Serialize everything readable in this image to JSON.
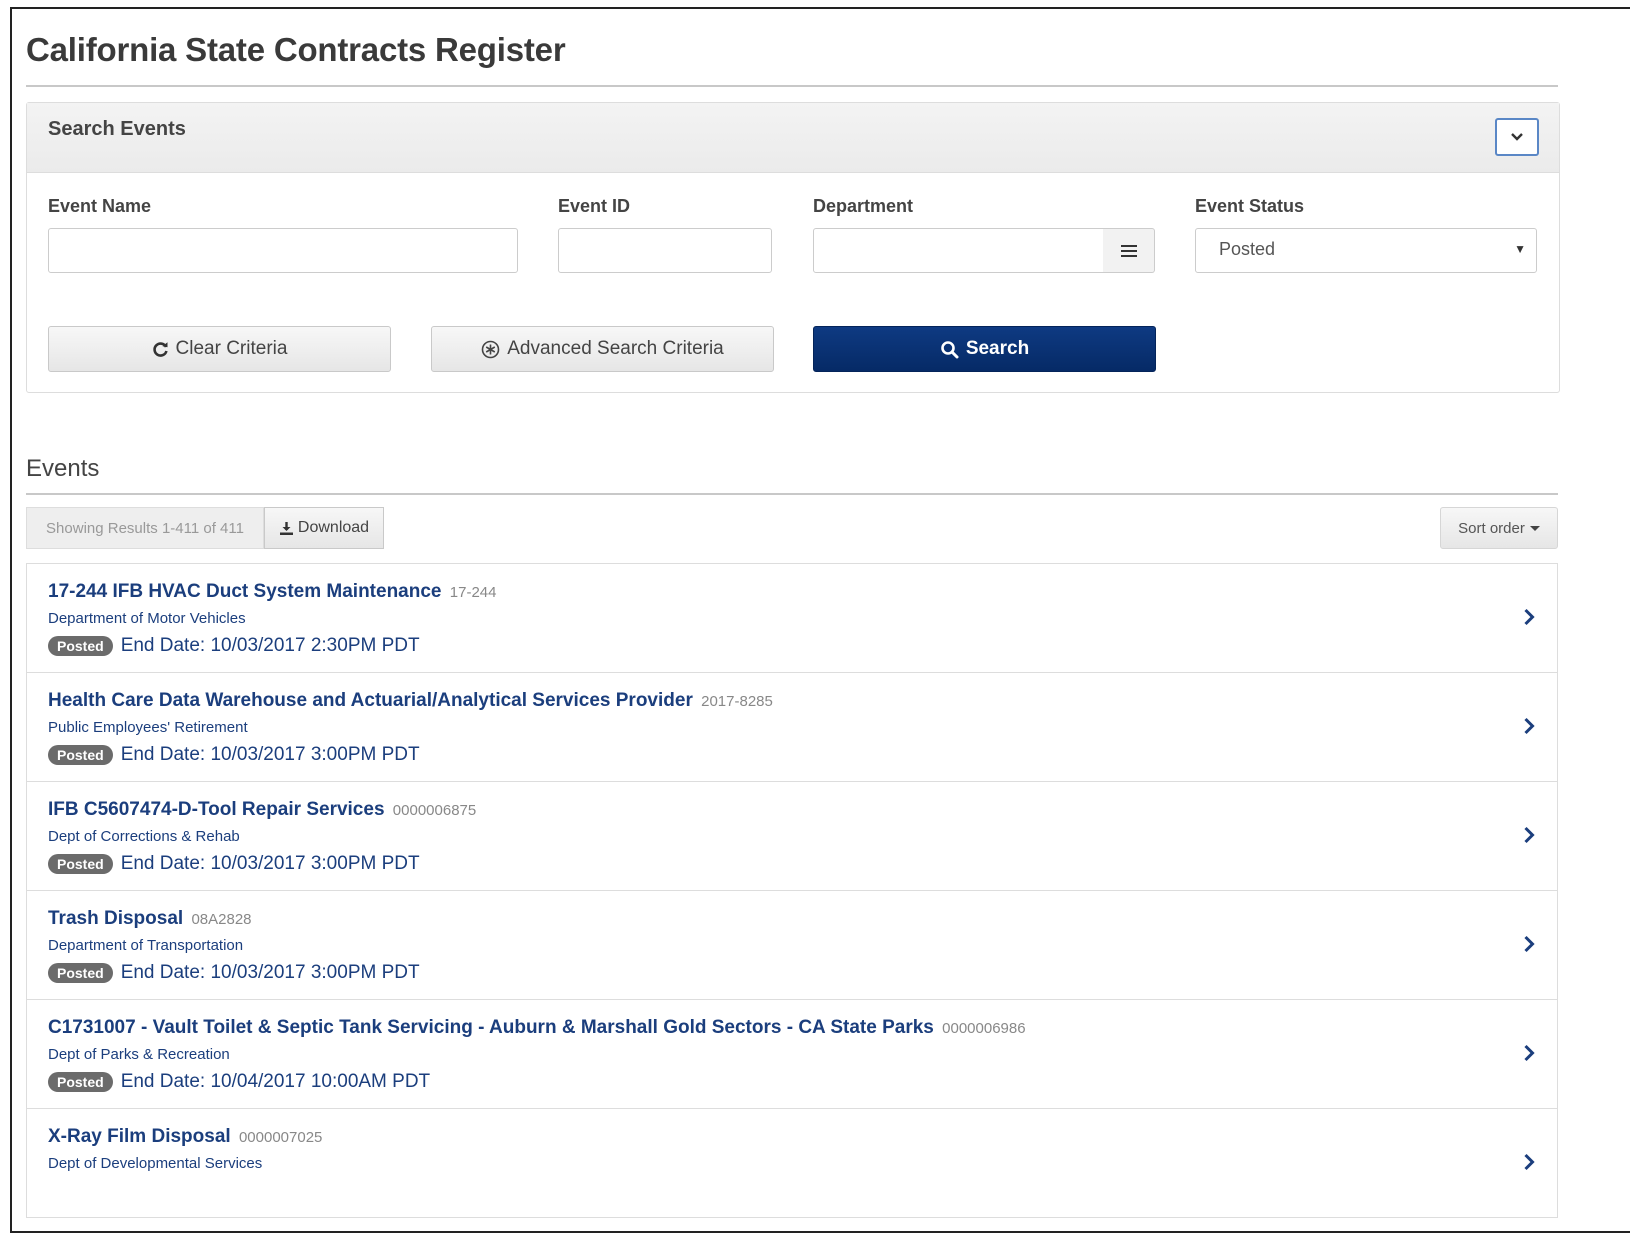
{
  "page": {
    "title": "California State Contracts Register"
  },
  "search_panel": {
    "title": "Search Events",
    "fields": {
      "event_name": {
        "label": "Event Name",
        "value": ""
      },
      "event_id": {
        "label": "Event ID",
        "value": ""
      },
      "department": {
        "label": "Department",
        "value": ""
      },
      "event_status": {
        "label": "Event Status",
        "value": "Posted"
      }
    },
    "buttons": {
      "clear": "Clear Criteria",
      "advanced": "Advanced Search Criteria",
      "search": "Search"
    }
  },
  "events": {
    "title": "Events",
    "results_text": "Showing Results 1-411 of 411",
    "download_label": "Download",
    "sort_label": "Sort order",
    "items": [
      {
        "name": "17-244 IFB HVAC Duct System Maintenance",
        "id": "17-244",
        "department": "Department of Motor Vehicles",
        "status": "Posted",
        "end_date": "End Date: 10/03/2017 2:30PM PDT"
      },
      {
        "name": "Health Care Data Warehouse and Actuarial/Analytical Services Provider",
        "id": "2017-8285",
        "department": "Public Employees' Retirement",
        "status": "Posted",
        "end_date": "End Date: 10/03/2017 3:00PM PDT"
      },
      {
        "name": "IFB C5607474-D-Tool Repair Services",
        "id": "0000006875",
        "department": "Dept of Corrections & Rehab",
        "status": "Posted",
        "end_date": "End Date: 10/03/2017 3:00PM PDT"
      },
      {
        "name": "Trash Disposal",
        "id": "08A2828",
        "department": "Department of Transportation",
        "status": "Posted",
        "end_date": "End Date: 10/03/2017 3:00PM PDT"
      },
      {
        "name": "C1731007 - Vault Toilet & Septic Tank Servicing - Auburn & Marshall Gold Sectors - CA State Parks",
        "id": "0000006986",
        "department": "Dept of Parks & Recreation",
        "status": "Posted",
        "end_date": "End Date: 10/04/2017 10:00AM PDT"
      },
      {
        "name": "X-Ray Film Disposal",
        "id": "0000007025",
        "department": "Dept of Developmental Services",
        "status": "",
        "end_date": ""
      }
    ]
  }
}
